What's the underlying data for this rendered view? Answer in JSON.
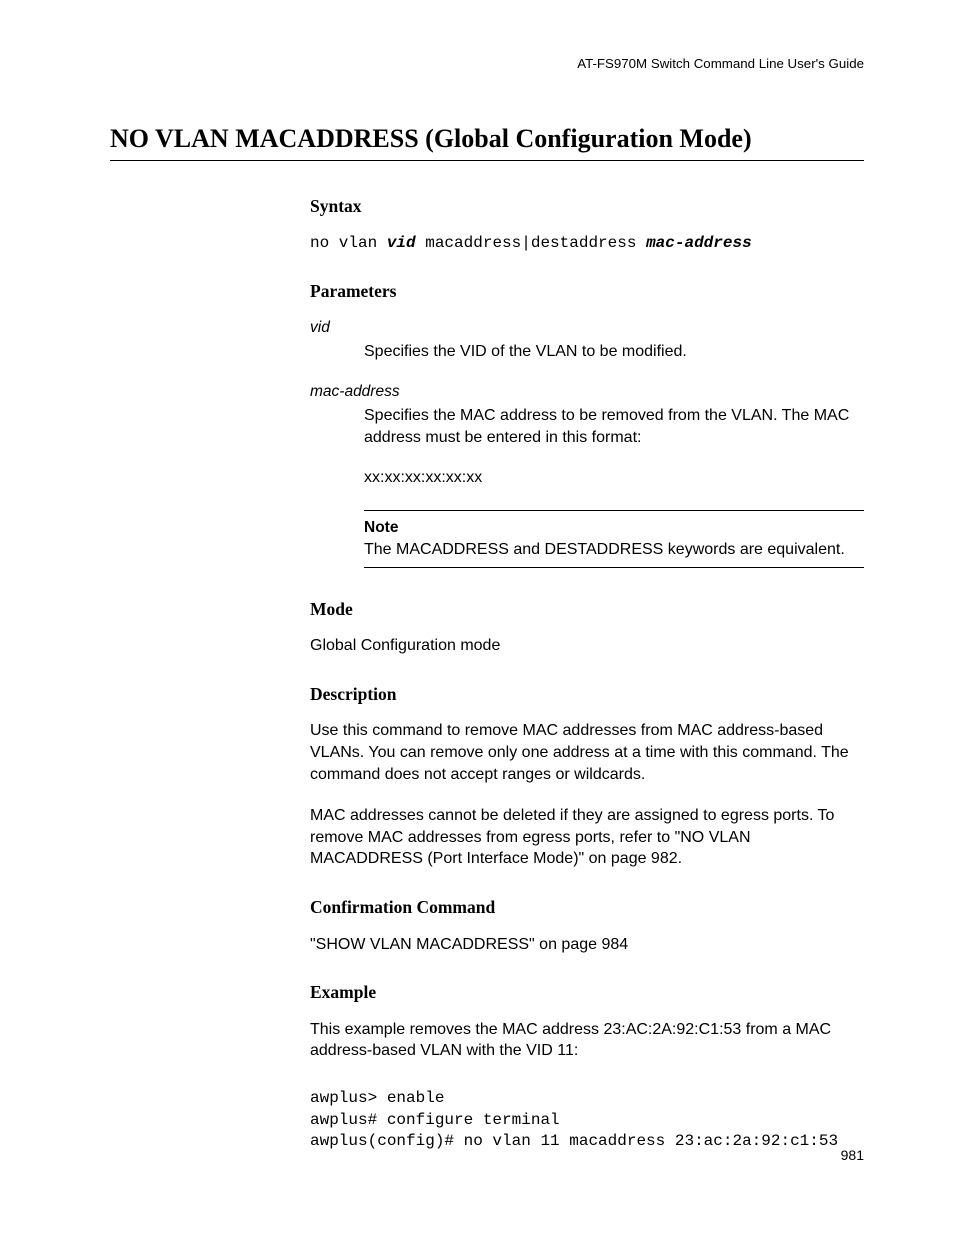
{
  "running_header": "AT-FS970M Switch Command Line User's Guide",
  "page_title": "NO VLAN MACADDRESS (Global Configuration Mode)",
  "syntax": {
    "heading": "Syntax",
    "parts": {
      "p1": "no vlan ",
      "v1": "vid",
      "p2": " macaddress|destaddress ",
      "v2": "mac-address"
    }
  },
  "parameters": {
    "heading": "Parameters",
    "items": [
      {
        "term": "vid",
        "desc": [
          "Specifies the VID of the VLAN to be modified."
        ]
      },
      {
        "term": "mac-address",
        "desc": [
          "Specifies the MAC address to be removed from the VLAN. The MAC address must be entered in this format:",
          "xx:xx:xx:xx:xx:xx"
        ]
      }
    ],
    "note": {
      "label": "Note",
      "text": "The MACADDRESS and DESTADDRESS keywords are equivalent."
    }
  },
  "mode": {
    "heading": "Mode",
    "text": "Global Configuration mode"
  },
  "description": {
    "heading": "Description",
    "paras": [
      "Use this command to remove MAC addresses from MAC address-based VLANs. You can remove only one address at a time with this command. The command does not accept ranges or wildcards.",
      "MAC addresses cannot be deleted if they are assigned to egress ports. To remove MAC addresses from egress ports, refer to \"NO VLAN MACADDRESS (Port Interface Mode)\" on page 982."
    ]
  },
  "confirmation": {
    "heading": "Confirmation Command",
    "text": "\"SHOW VLAN MACADDRESS\" on page 984"
  },
  "example": {
    "heading": "Example",
    "intro": "This example removes the MAC address 23:AC:2A:92:C1:53 from a MAC address-based VLAN with the VID 11:",
    "code": "awplus> enable\nawplus# configure terminal\nawplus(config)# no vlan 11 macaddress 23:ac:2a:92:c1:53"
  },
  "page_number": "981"
}
